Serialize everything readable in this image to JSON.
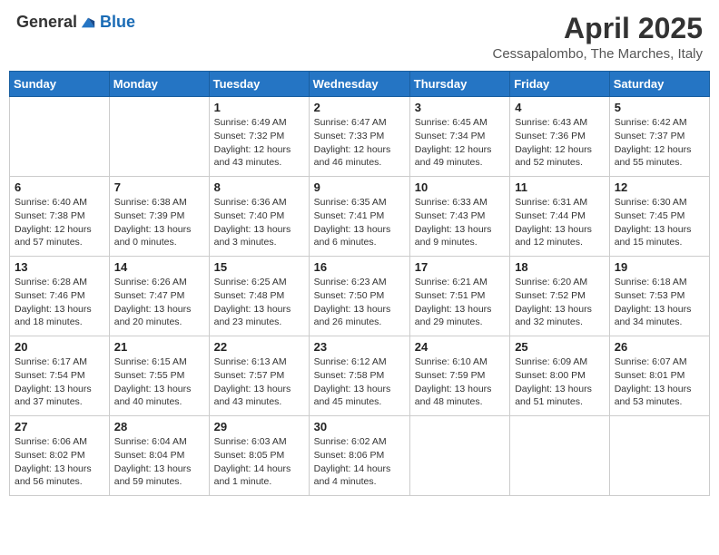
{
  "header": {
    "logo_general": "General",
    "logo_blue": "Blue",
    "month": "April 2025",
    "location": "Cessapalombo, The Marches, Italy"
  },
  "weekdays": [
    "Sunday",
    "Monday",
    "Tuesday",
    "Wednesday",
    "Thursday",
    "Friday",
    "Saturday"
  ],
  "weeks": [
    [
      {
        "day": "",
        "info": ""
      },
      {
        "day": "",
        "info": ""
      },
      {
        "day": "1",
        "info": "Sunrise: 6:49 AM\nSunset: 7:32 PM\nDaylight: 12 hours and 43 minutes."
      },
      {
        "day": "2",
        "info": "Sunrise: 6:47 AM\nSunset: 7:33 PM\nDaylight: 12 hours and 46 minutes."
      },
      {
        "day": "3",
        "info": "Sunrise: 6:45 AM\nSunset: 7:34 PM\nDaylight: 12 hours and 49 minutes."
      },
      {
        "day": "4",
        "info": "Sunrise: 6:43 AM\nSunset: 7:36 PM\nDaylight: 12 hours and 52 minutes."
      },
      {
        "day": "5",
        "info": "Sunrise: 6:42 AM\nSunset: 7:37 PM\nDaylight: 12 hours and 55 minutes."
      }
    ],
    [
      {
        "day": "6",
        "info": "Sunrise: 6:40 AM\nSunset: 7:38 PM\nDaylight: 12 hours and 57 minutes."
      },
      {
        "day": "7",
        "info": "Sunrise: 6:38 AM\nSunset: 7:39 PM\nDaylight: 13 hours and 0 minutes."
      },
      {
        "day": "8",
        "info": "Sunrise: 6:36 AM\nSunset: 7:40 PM\nDaylight: 13 hours and 3 minutes."
      },
      {
        "day": "9",
        "info": "Sunrise: 6:35 AM\nSunset: 7:41 PM\nDaylight: 13 hours and 6 minutes."
      },
      {
        "day": "10",
        "info": "Sunrise: 6:33 AM\nSunset: 7:43 PM\nDaylight: 13 hours and 9 minutes."
      },
      {
        "day": "11",
        "info": "Sunrise: 6:31 AM\nSunset: 7:44 PM\nDaylight: 13 hours and 12 minutes."
      },
      {
        "day": "12",
        "info": "Sunrise: 6:30 AM\nSunset: 7:45 PM\nDaylight: 13 hours and 15 minutes."
      }
    ],
    [
      {
        "day": "13",
        "info": "Sunrise: 6:28 AM\nSunset: 7:46 PM\nDaylight: 13 hours and 18 minutes."
      },
      {
        "day": "14",
        "info": "Sunrise: 6:26 AM\nSunset: 7:47 PM\nDaylight: 13 hours and 20 minutes."
      },
      {
        "day": "15",
        "info": "Sunrise: 6:25 AM\nSunset: 7:48 PM\nDaylight: 13 hours and 23 minutes."
      },
      {
        "day": "16",
        "info": "Sunrise: 6:23 AM\nSunset: 7:50 PM\nDaylight: 13 hours and 26 minutes."
      },
      {
        "day": "17",
        "info": "Sunrise: 6:21 AM\nSunset: 7:51 PM\nDaylight: 13 hours and 29 minutes."
      },
      {
        "day": "18",
        "info": "Sunrise: 6:20 AM\nSunset: 7:52 PM\nDaylight: 13 hours and 32 minutes."
      },
      {
        "day": "19",
        "info": "Sunrise: 6:18 AM\nSunset: 7:53 PM\nDaylight: 13 hours and 34 minutes."
      }
    ],
    [
      {
        "day": "20",
        "info": "Sunrise: 6:17 AM\nSunset: 7:54 PM\nDaylight: 13 hours and 37 minutes."
      },
      {
        "day": "21",
        "info": "Sunrise: 6:15 AM\nSunset: 7:55 PM\nDaylight: 13 hours and 40 minutes."
      },
      {
        "day": "22",
        "info": "Sunrise: 6:13 AM\nSunset: 7:57 PM\nDaylight: 13 hours and 43 minutes."
      },
      {
        "day": "23",
        "info": "Sunrise: 6:12 AM\nSunset: 7:58 PM\nDaylight: 13 hours and 45 minutes."
      },
      {
        "day": "24",
        "info": "Sunrise: 6:10 AM\nSunset: 7:59 PM\nDaylight: 13 hours and 48 minutes."
      },
      {
        "day": "25",
        "info": "Sunrise: 6:09 AM\nSunset: 8:00 PM\nDaylight: 13 hours and 51 minutes."
      },
      {
        "day": "26",
        "info": "Sunrise: 6:07 AM\nSunset: 8:01 PM\nDaylight: 13 hours and 53 minutes."
      }
    ],
    [
      {
        "day": "27",
        "info": "Sunrise: 6:06 AM\nSunset: 8:02 PM\nDaylight: 13 hours and 56 minutes."
      },
      {
        "day": "28",
        "info": "Sunrise: 6:04 AM\nSunset: 8:04 PM\nDaylight: 13 hours and 59 minutes."
      },
      {
        "day": "29",
        "info": "Sunrise: 6:03 AM\nSunset: 8:05 PM\nDaylight: 14 hours and 1 minute."
      },
      {
        "day": "30",
        "info": "Sunrise: 6:02 AM\nSunset: 8:06 PM\nDaylight: 14 hours and 4 minutes."
      },
      {
        "day": "",
        "info": ""
      },
      {
        "day": "",
        "info": ""
      },
      {
        "day": "",
        "info": ""
      }
    ]
  ]
}
